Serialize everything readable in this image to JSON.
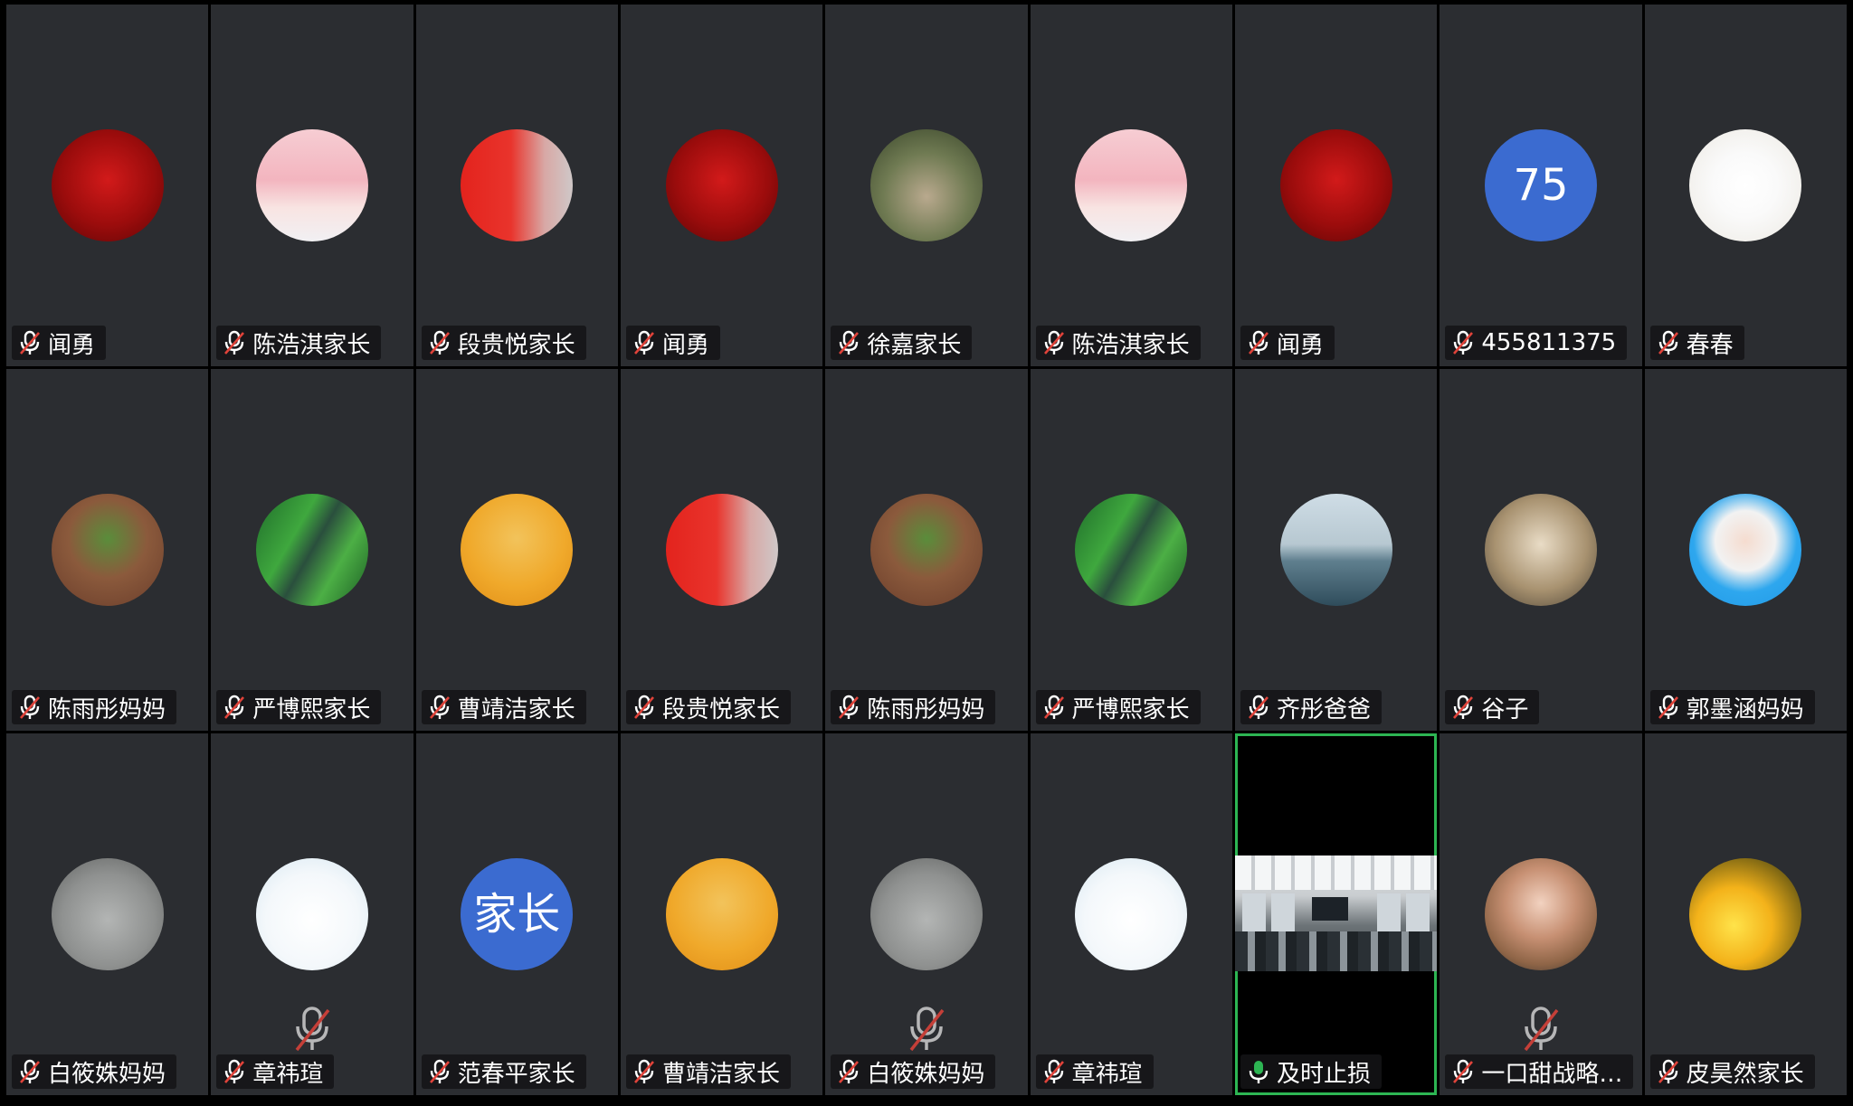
{
  "participants": [
    {
      "name": "闻勇",
      "avatar": "ac-milan-crest",
      "mic": "muted"
    },
    {
      "name": "陈浩淇家长",
      "avatar": "silhouette-pink-sky",
      "mic": "muted"
    },
    {
      "name": "段贵悦家长",
      "avatar": "china-flag-silhouette",
      "mic": "muted"
    },
    {
      "name": "闻勇",
      "avatar": "ac-milan-crest",
      "mic": "muted"
    },
    {
      "name": "徐嘉家长",
      "avatar": "stone-statue-forest",
      "mic": "muted"
    },
    {
      "name": "陈浩淇家长",
      "avatar": "silhouette-pink-sky",
      "mic": "muted"
    },
    {
      "name": "闻勇",
      "avatar": "ac-milan-crest",
      "mic": "muted"
    },
    {
      "name": "455811375",
      "avatar": "text-badge",
      "avatar_text": "75",
      "mic": "muted"
    },
    {
      "name": "春春",
      "avatar": "koi-fish-lotus",
      "mic": "muted"
    },
    {
      "name": "陈雨彤妈妈",
      "avatar": "plant-on-brick",
      "mic": "muted"
    },
    {
      "name": "严博熙家长",
      "avatar": "forest-road-car",
      "mic": "muted"
    },
    {
      "name": "曹靖洁家长",
      "avatar": "pomeranian-dog",
      "mic": "muted"
    },
    {
      "name": "段贵悦家长",
      "avatar": "china-flag-silhouette",
      "mic": "muted"
    },
    {
      "name": "陈雨彤妈妈",
      "avatar": "plant-on-brick",
      "mic": "muted"
    },
    {
      "name": "严博熙家长",
      "avatar": "forest-road-car",
      "mic": "muted"
    },
    {
      "name": "齐彤爸爸",
      "avatar": "sea-with-flag",
      "mic": "muted"
    },
    {
      "name": "谷子",
      "avatar": "elf-portrait",
      "mic": "muted"
    },
    {
      "name": "郭墨涵妈妈",
      "avatar": "woman-portrait-blue",
      "mic": "muted"
    },
    {
      "name": "白筱姝妈妈",
      "avatar": "black-swans",
      "mic": "muted"
    },
    {
      "name": "章祎瑄",
      "avatar": "tangyuan-bowl",
      "mic": "muted",
      "center_mic": true
    },
    {
      "name": "范春平家长",
      "avatar": "text-badge",
      "avatar_text": "家长",
      "mic": "muted"
    },
    {
      "name": "曹靖洁家长",
      "avatar": "pomeranian-dog",
      "mic": "muted"
    },
    {
      "name": "白筱姝妈妈",
      "avatar": "black-swans",
      "mic": "muted",
      "center_mic": true
    },
    {
      "name": "章祎瑄",
      "avatar": "tangyuan-bowl",
      "mic": "muted"
    },
    {
      "name": "及时止损",
      "avatar": "video",
      "mic": "active",
      "video": true
    },
    {
      "name": "一口甜战略…",
      "avatar": "woman-portrait-blonde",
      "mic": "muted",
      "center_mic": true
    },
    {
      "name": "皮昊然家长",
      "avatar": "golden-tree-sunset",
      "mic": "muted"
    }
  ],
  "colors": {
    "tile_bg": "#2b2d31",
    "badge_blue": "#3b6bd0",
    "active_border": "#2db553",
    "mute_red": "#e0433a"
  },
  "icons": {
    "muted": "mic-muted-icon",
    "active": "mic-active-icon"
  }
}
